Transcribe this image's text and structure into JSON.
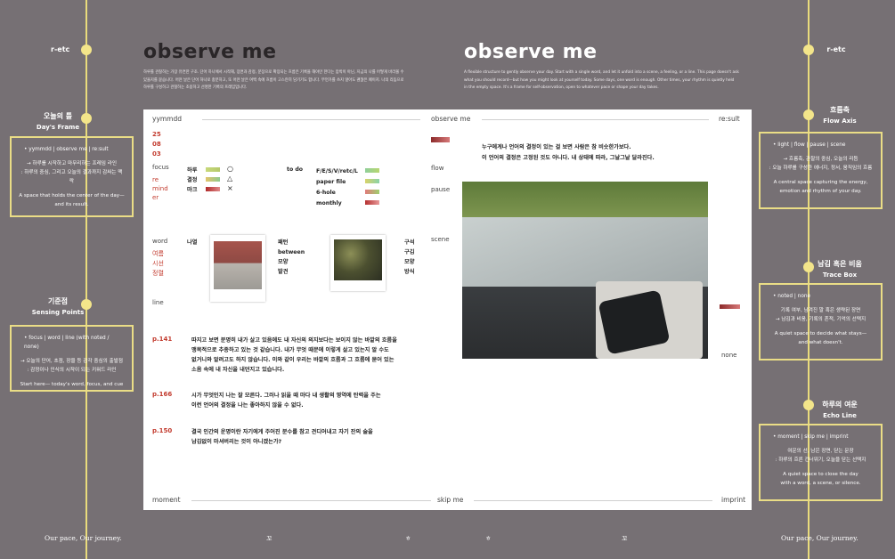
{
  "colors": {
    "background": "#767074",
    "accent": "#e9db7c",
    "red": "#c23a2d",
    "page": "#ffffff"
  },
  "left": {
    "top_label": "r-etc",
    "section1": {
      "title": "오늘의 틀",
      "sub": "Day's Frame",
      "lead": "• yymmdd | observe me | re:sult",
      "lines": [
        "→ 하루를 시작하고 마무리하는 프레임 라인",
        ": 하루의 중심, 그리고 오늘의 결과까지 감싸는 맥락"
      ],
      "en": [
        "A space that holds the center of the day—",
        "and its result."
      ]
    },
    "section2": {
      "title": "기준점",
      "sub": "Sensing Points",
      "lead": "• focus | word | line (with noted / none)",
      "lines": [
        "→ 오늘의 단어, 초점, 장을 등 감각 중심의 출발점",
        ": 감정이나 인식의 시작이 되는 키워드 라인"
      ],
      "en": [
        "Start here— today's word, focus, and cue"
      ]
    },
    "footer": "Our pace, Our journey."
  },
  "right": {
    "top_label": "r-etc",
    "section1": {
      "title": "흐름축",
      "sub": "Flow Axis",
      "lead": "• light | flow | pause | scene",
      "lines": [
        "→ 흐름축, 관찰의 중심, 오늘의 리듬",
        ": 오늘 하루를 구성한 에너지, 정서, 움직임의 흐름"
      ],
      "en": [
        "A central space capturing the energy,",
        "emotion and rhythm of your day."
      ]
    },
    "section2": {
      "title": "남김 혹은 비움",
      "sub": "Trace Box",
      "lead": "• noted | none",
      "lines": [
        "기록 여부, 남겨진 말 혹은 생략된 장면",
        "→ 남김과 비움, 기록의 흔적, 기억의 선택지"
      ],
      "en": [
        "A quiet space to decide what stays—",
        "and what doesn't."
      ]
    },
    "section3": {
      "title": "하루의 여운",
      "sub": "Echo Line",
      "lead": "• moment | skip me | imprint",
      "lines": [
        "여운의 선, 남은 장면, 닫는 문장",
        ": 하루의 흐른 건너뛰기, 오늘을 닫는 선택지"
      ],
      "en": [
        "A quiet space to close the day",
        "with a word, a scene, or silence."
      ]
    },
    "footer": "Our pace, Our journey."
  },
  "headers": {
    "left_title": "observe me",
    "left_intro": [
      "하루를 관찰하는 가장 유연한 구조. 단어 하나에서 시작해, 장면과 감정, 문장으로 확장되는 흐름은 기록을 해야만 한다는 압박이 아닌, 지금의 나를 어떻게 바라볼 수",
      "있을지를 묻습니다. 어떤 날은 단어 하나로 충분하고, 또 어떤 날은 여백 속에 흐름이 고스란히 담기기도 합니다. 무언가를 쓰지 않아도 괜찮은 페이지. 나의 리듬으로",
      "하루를 구성하고 관찰하는 조용하고 선명한 기록의 프레임입니다."
    ],
    "right_title": "observe me",
    "right_intro": [
      "A flexible structure to gently observe your day. Start with a single word, and let it unfold into a scene, a feeling, or a line. This page doesn't ask",
      "what you should record—but how you might look at yourself today. Some days, one word is enough. Other times, your rhythm is quietly held",
      "in the empty space. It's a frame for self-observation, open to whatever pace or shape your day takes."
    ]
  },
  "page": {
    "top_left": "yymmdd",
    "top_center": "observe me",
    "top_right": "re:sult",
    "date": [
      "25",
      "08",
      "03"
    ],
    "focus": {
      "label": "focus",
      "red": [
        "re",
        "mind",
        "er"
      ],
      "items": [
        "하루",
        "결정",
        "마크"
      ],
      "symbols": [
        "○",
        "△",
        "×"
      ]
    },
    "todo": {
      "label": "to do",
      "items": [
        "F/E/S/V/retc/L",
        "paper file",
        "6-hole",
        "monthly"
      ]
    },
    "word": {
      "label": "word",
      "red": [
        "여름",
        "시선",
        "정렬"
      ],
      "first": "나열",
      "middle": [
        "패턴",
        "between",
        "모양",
        "발견"
      ],
      "right": [
        "구석",
        "",
        "구김",
        "모양",
        "방식"
      ]
    },
    "line_label": "line",
    "quotes": [
      {
        "page": "p.141",
        "lines": [
          "따지고 보면 분명히 내가 살고 있음에도 내 자신의 의지보다는 보이지 않는 바깥의 흐름을",
          "맹목적으로 추종하고 있는 것 같습니다. 내가 무엇 때문에 이렇게 살고 있는지 알 수도",
          "없거니와 알려고도 하지 않습니다. 이와 같이 우리는 바깥의 흐름과 그 흐름에 묻어 있는",
          "소음 속에 내 자신을 내던지고 있습니다."
        ]
      },
      {
        "page": "p.166",
        "lines": [
          "시가 무엇인지 나는 잘 모른다. 그러나 읽을 때 마다 내 생활의 영역에 탄력을 주는",
          "이런 언어의 결정을 나는 좋아하지 않을 수 없다."
        ]
      },
      {
        "page": "p.150",
        "lines": [
          "결국 인간의 운명이란 자기에게 주어진 분수를 참고 견디어내고 자기 잔의 술을",
          "남김없이 마셔버리는 것이 아니겠는가?"
        ]
      }
    ],
    "flow": {
      "items": [
        "flow",
        "pause",
        "scene"
      ],
      "text": [
        "누구에게나 언어의 결정이 있는 걸 보면 사람은 참 비슷한가보다.",
        "이 언어의 결정은 고정된 것도 아니다. 내 상태에 따라, 그날그날 달라진다."
      ]
    },
    "trace": "none",
    "bottom_left": "moment",
    "bottom_center": "skip me",
    "bottom_right": "imprint"
  },
  "footer_glyphs": [
    "꼬",
    "ㅎ",
    "ㅎ",
    "꼬"
  ]
}
